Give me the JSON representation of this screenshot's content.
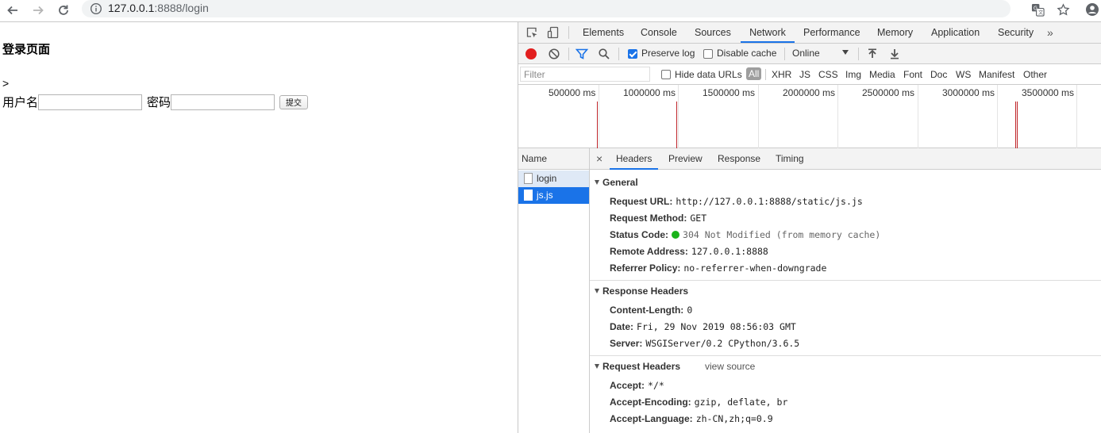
{
  "browser": {
    "url_host": "127.0.0.1",
    "url_rest": ":8888/login"
  },
  "page": {
    "title": "登录页面",
    "gt": ">",
    "username_label": "用户名",
    "password_label": "密码",
    "submit_label": "提交"
  },
  "devtools": {
    "tabs": [
      "Elements",
      "Console",
      "Sources",
      "Network",
      "Performance",
      "Memory",
      "Application",
      "Security"
    ],
    "active_tab": "Network",
    "more": "»",
    "toolbar": {
      "preserve_log": "Preserve log",
      "disable_cache": "Disable cache",
      "throttling": "Online"
    },
    "filter": {
      "placeholder": "Filter",
      "hide_data_urls": "Hide data URLs",
      "types": [
        "All",
        "XHR",
        "JS",
        "CSS",
        "Img",
        "Media",
        "Font",
        "Doc",
        "WS",
        "Manifest",
        "Other"
      ]
    },
    "timeline": {
      "labels": [
        "500000 ms",
        "1000000 ms",
        "1500000 ms",
        "2000000 ms",
        "2500000 ms",
        "3000000 ms",
        "3500000 ms"
      ]
    },
    "name_header": "Name",
    "requests": [
      "login",
      "js.js"
    ],
    "selected_request": "js.js",
    "detail_tabs": [
      "Headers",
      "Preview",
      "Response",
      "Timing"
    ],
    "close": "×",
    "general": {
      "title": "General",
      "rows": [
        {
          "k": "Request URL:",
          "v": "http://127.0.0.1:8888/static/js.js"
        },
        {
          "k": "Request Method:",
          "v": "GET"
        },
        {
          "k": "Status Code:",
          "v": "304 Not Modified (from memory cache)"
        },
        {
          "k": "Remote Address:",
          "v": "127.0.0.1:8888"
        },
        {
          "k": "Referrer Policy:",
          "v": "no-referrer-when-downgrade"
        }
      ]
    },
    "response_headers": {
      "title": "Response Headers",
      "rows": [
        {
          "k": "Content-Length:",
          "v": "0"
        },
        {
          "k": "Date:",
          "v": "Fri, 29 Nov 2019 08:56:03 GMT"
        },
        {
          "k": "Server:",
          "v": "WSGIServer/0.2 CPython/3.6.5"
        }
      ]
    },
    "request_headers": {
      "title": "Request Headers",
      "view_source": "view source",
      "rows": [
        {
          "k": "Accept:",
          "v": "*/*"
        },
        {
          "k": "Accept-Encoding:",
          "v": "gzip, deflate, br"
        },
        {
          "k": "Accept-Language:",
          "v": "zh-CN,zh;q=0.9"
        }
      ]
    }
  }
}
